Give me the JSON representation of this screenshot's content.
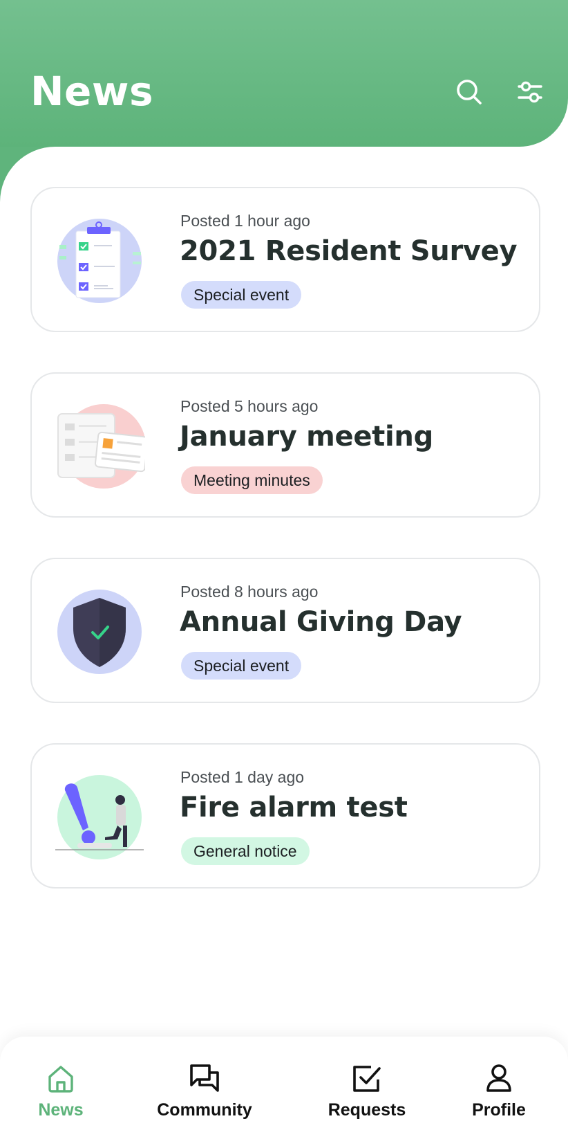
{
  "header": {
    "title": "News",
    "search_icon": "search-icon",
    "filter_icon": "sliders-icon"
  },
  "news": [
    {
      "posted": "Posted 1 hour ago",
      "title": "2021 Resident Survey",
      "tag": "Special event",
      "tag_color": "#d4dcfb",
      "thumb_icon": "survey-clipboard-illustration"
    },
    {
      "posted": "Posted 5 hours ago",
      "title": "January meeting",
      "tag": "Meeting minutes",
      "tag_color": "#f9d2d2",
      "thumb_icon": "meeting-documents-illustration"
    },
    {
      "posted": "Posted 8 hours ago",
      "title": "Annual Giving Day",
      "tag": "Special event",
      "tag_color": "#d4dcfb",
      "thumb_icon": "shield-check-illustration"
    },
    {
      "posted": "Posted 1 day ago",
      "title": "Fire alarm test",
      "tag": "General notice",
      "tag_color": "#d2f7e3",
      "thumb_icon": "exclamation-person-illustration"
    }
  ],
  "bottom_nav": {
    "items": [
      {
        "label": "News",
        "icon": "home-icon",
        "active": true
      },
      {
        "label": "Community",
        "icon": "chat-bubbles-icon",
        "active": false
      },
      {
        "label": "Requests",
        "icon": "checkbox-icon",
        "active": false
      },
      {
        "label": "Profile",
        "icon": "person-icon",
        "active": false
      }
    ]
  },
  "colors": {
    "brand_green": "#5db37a",
    "header_gradient_top": "#74c08f",
    "text_dark": "#25302e",
    "card_border": "#e5e7e9"
  }
}
